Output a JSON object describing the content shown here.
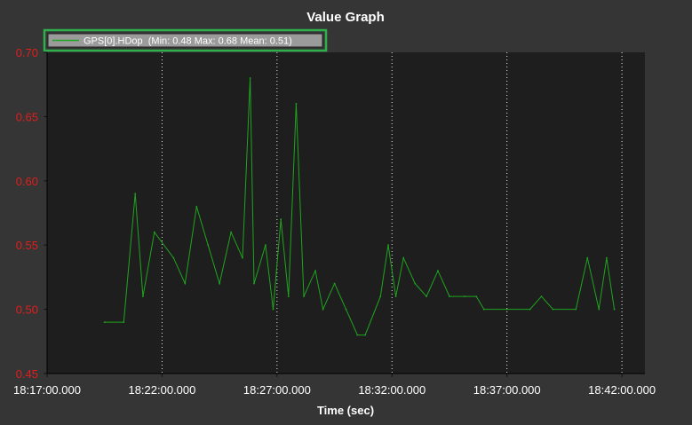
{
  "chart_data": {
    "type": "line",
    "title": "Value Graph",
    "xlabel": "Time (sec)",
    "ylabel": "",
    "xlim": [
      "18:17:00",
      "18:43:00"
    ],
    "ylim": [
      0.45,
      0.7
    ],
    "grid": true,
    "legend_position": "top-left",
    "x_tick_labels": [
      "18:17:00.000",
      "18:22:00.000",
      "18:27:00.000",
      "18:32:00.000",
      "18:37:00.000",
      "18:42:00.000"
    ],
    "y_tick_labels": [
      "0.45",
      "0.50",
      "0.55",
      "0.60",
      "0.65",
      "0.70"
    ],
    "series": [
      {
        "name": "GPS[0].HDop",
        "legend_label": "GPS[0].HDop  (Min: 0.48 Max: 0.68 Mean: 0.51)",
        "color": "#1fa51f",
        "x": [
          "18:19:30",
          "18:20:20",
          "18:20:50",
          "18:21:10",
          "18:21:40",
          "18:22:30",
          "18:23:00",
          "18:23:30",
          "18:24:00",
          "18:24:30",
          "18:25:00",
          "18:25:30",
          "18:25:50",
          "18:26:00",
          "18:26:30",
          "18:26:50",
          "18:27:10",
          "18:27:30",
          "18:27:50",
          "18:28:10",
          "18:28:40",
          "18:29:00",
          "18:29:30",
          "18:30:00",
          "18:30:30",
          "18:30:50",
          "18:31:30",
          "18:31:50",
          "18:32:10",
          "18:32:30",
          "18:33:00",
          "18:33:30",
          "18:34:00",
          "18:34:30",
          "18:35:10",
          "18:35:40",
          "18:36:00",
          "18:37:00",
          "18:38:00",
          "18:38:30",
          "18:39:00",
          "18:40:00",
          "18:40:30",
          "18:41:00",
          "18:41:20",
          "18:41:40"
        ],
        "values": [
          0.49,
          0.49,
          0.59,
          0.51,
          0.56,
          0.54,
          0.52,
          0.58,
          0.55,
          0.52,
          0.56,
          0.54,
          0.68,
          0.52,
          0.55,
          0.5,
          0.57,
          0.51,
          0.66,
          0.51,
          0.53,
          0.5,
          0.52,
          0.5,
          0.48,
          0.48,
          0.51,
          0.55,
          0.51,
          0.54,
          0.52,
          0.51,
          0.53,
          0.51,
          0.51,
          0.51,
          0.5,
          0.5,
          0.5,
          0.51,
          0.5,
          0.5,
          0.54,
          0.5,
          0.54,
          0.5
        ]
      }
    ]
  }
}
